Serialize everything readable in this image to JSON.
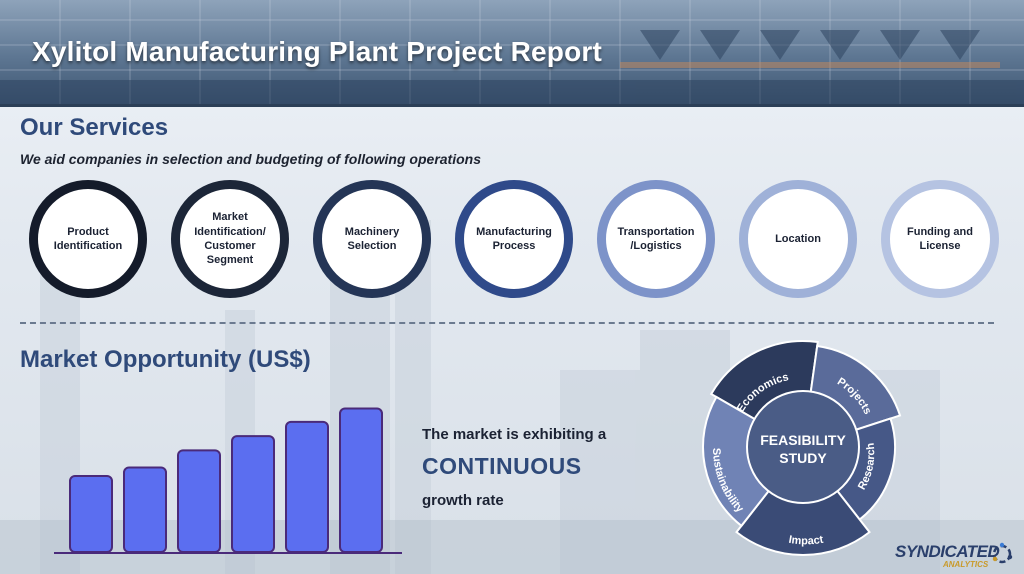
{
  "header": {
    "title": "Xylitol Manufacturing Plant Project Report"
  },
  "services": {
    "title": "Our Services",
    "subtitle": "We aid companies in selection and budgeting of following operations",
    "items": [
      {
        "label": "Product Identification",
        "ring_color": "#141b2a"
      },
      {
        "label": "Market Identification/ Customer Segment",
        "ring_color": "#1c2638"
      },
      {
        "label": "Machinery Selection",
        "ring_color": "#243556"
      },
      {
        "label": "Manufacturing Process",
        "ring_color": "#2f4a8a"
      },
      {
        "label": "Transportation /Logistics",
        "ring_color": "#7d93c9"
      },
      {
        "label": "Location",
        "ring_color": "#9fb1d8"
      },
      {
        "label": "Funding and License",
        "ring_color": "#b5c3e2"
      }
    ]
  },
  "market": {
    "title": "Market Opportunity (US$)",
    "line1": "The market is exhibiting a",
    "emphasis": "CONTINUOUS",
    "line3": "growth rate"
  },
  "chart_data": {
    "type": "bar",
    "categories": [
      "",
      "",
      "",
      "",
      "",
      ""
    ],
    "values": [
      80,
      89,
      107,
      122,
      137,
      151
    ],
    "ylim": [
      0,
      160
    ],
    "bar_color": "#5b6ef0",
    "bar_stroke": "#4a2a7a"
  },
  "feasibility": {
    "center": "FEASIBILITY STUDY",
    "segments": [
      "Economics",
      "Projects",
      "Research",
      "Impact",
      "Sustainability"
    ]
  },
  "logo": {
    "main": "SYNDICATED",
    "sub": "ANALYTICS"
  }
}
